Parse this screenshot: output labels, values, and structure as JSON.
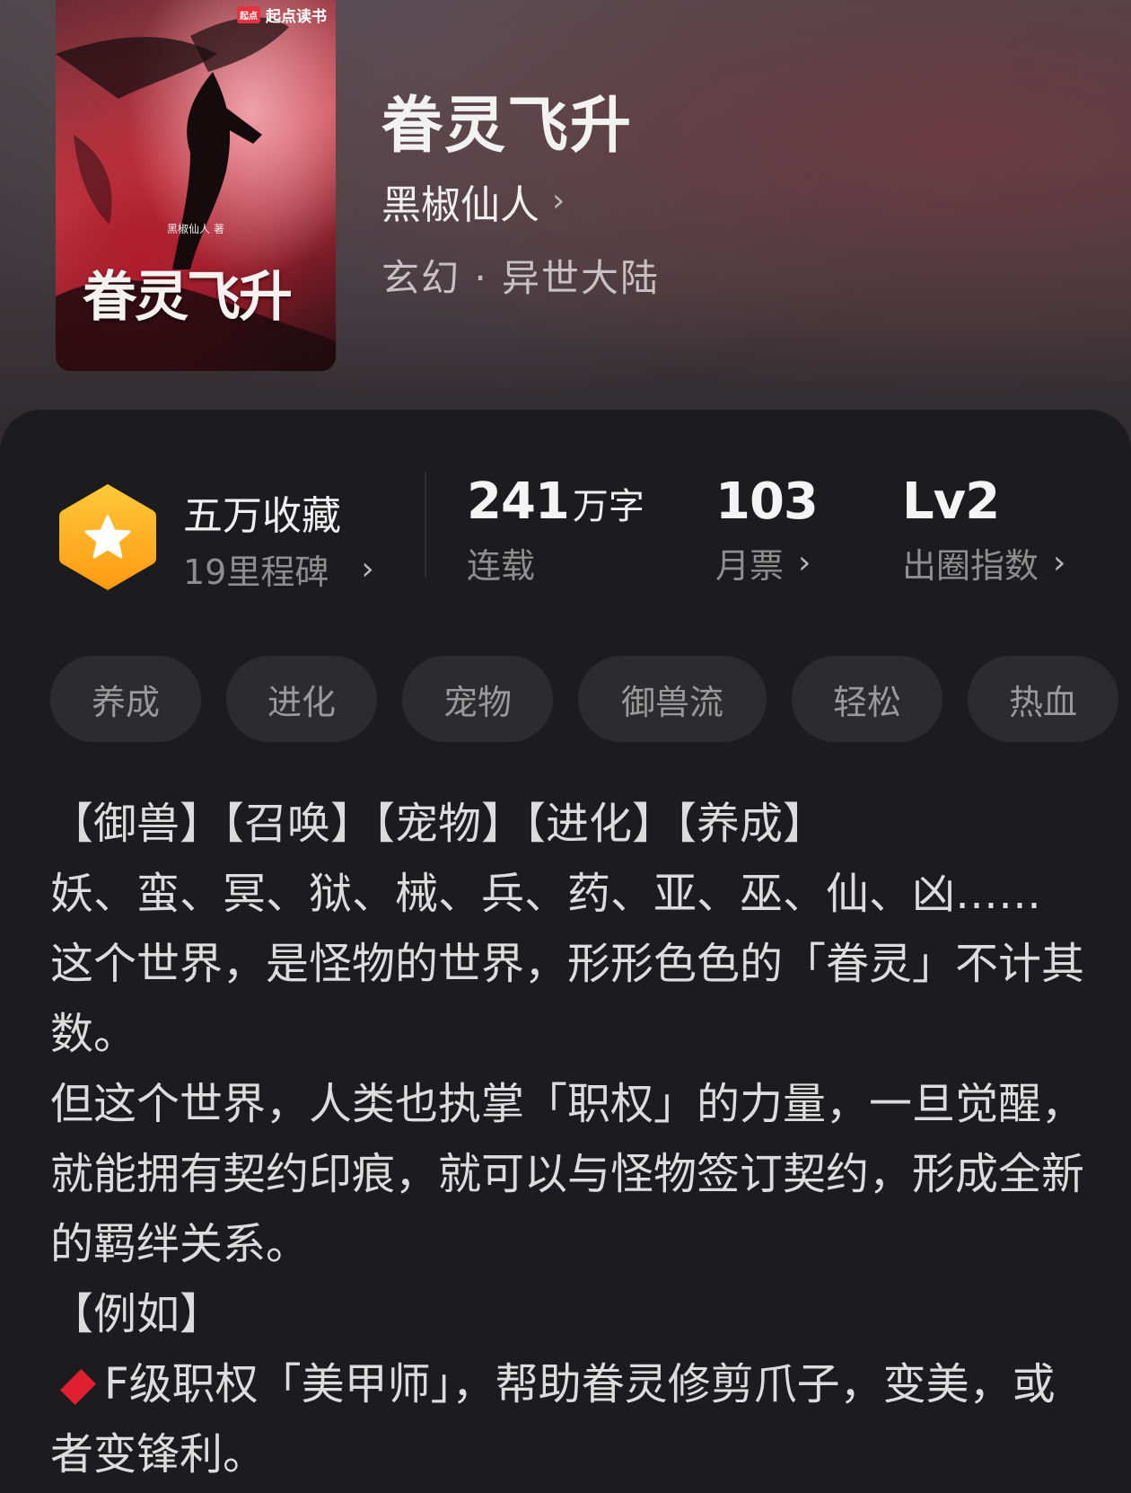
{
  "cover": {
    "badge_logo": "起点",
    "badge_text": "起点读书",
    "author_line": "黑椒仙人 著",
    "title": "眷灵飞升"
  },
  "book": {
    "title": "眷灵飞升",
    "author": "黑椒仙人",
    "genre": "玄幻 · 异世大陆"
  },
  "stats": {
    "favorites": "五万收藏",
    "milestones": "19里程碑",
    "words_number": "241",
    "words_unit": "万字",
    "status": "连载",
    "monthly_votes": "103",
    "monthly_votes_label": "月票",
    "level": "Lv2",
    "level_label": "出圈指数"
  },
  "tags": [
    "养成",
    "进化",
    "宠物",
    "御兽流",
    "轻松",
    "热血"
  ],
  "description": [
    "【御兽】【召唤】【宠物】【进化】【养成】",
    "妖、蛮、冥、狱、械、兵、药、亚、巫、仙、凶……",
    "这个世界，是怪物的世界，形形色色的「眷灵」不计其数。",
    "但这个世界，人类也执掌「职权」的力量，一旦觉醒，就能拥有契约印痕，就可以与怪物签订契约，形成全新的羁绊关系。",
    "【例如】",
    "F级职权「美甲师」，帮助眷灵修剪爪子，变美，或者变锋利。"
  ],
  "colors": {
    "accent_gold": "#ffb21a",
    "diamond_red": "#e02030",
    "panel_bg": "#1c1c1e"
  }
}
